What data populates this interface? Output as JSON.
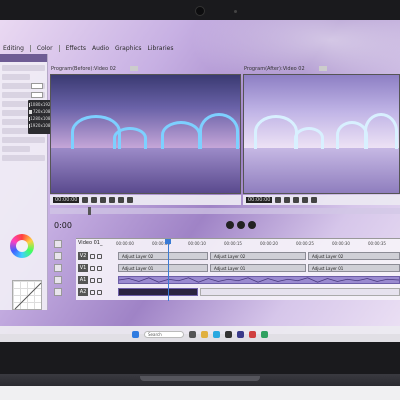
{
  "menu": {
    "items": [
      "Editing",
      "Color",
      "Effects",
      "Audio",
      "Graphics",
      "Libraries"
    ]
  },
  "left_panel": {
    "presets": [
      "1080x1920",
      "720x1080",
      "1280x1080",
      "1920x1080"
    ]
  },
  "monitors": {
    "before_title": "Program(Before):Video 02",
    "after_title": "Program(After):Video 02",
    "before_timecode": "00:00:00",
    "after_timecode": "00:00:00"
  },
  "playback": {
    "current_time": "0:00"
  },
  "timeline": {
    "sequence_tab": "Video 01_",
    "ruler": [
      "00:00:00",
      "00:00:05",
      "00:00:10",
      "00:00:15",
      "00:00:20",
      "00:00:25",
      "00:00:30",
      "00:00:35"
    ],
    "tracks": [
      {
        "label": "V2",
        "clip": "Adjust Layer 02"
      },
      {
        "label": "V1",
        "clip": "Adjust Layer 01"
      },
      {
        "label": "A1",
        "clip": ""
      },
      {
        "label": "A2",
        "clip": ""
      }
    ],
    "v2_clips": [
      "Adjust Layer 02",
      "Adjust Layer 02",
      "Adjust Layer 02"
    ],
    "v1_clips": [
      "Adjust Layer 01",
      "Adjust Layer 01",
      "Adjust Layer 01"
    ]
  },
  "taskbar": {
    "search_placeholder": "Search"
  },
  "colors": {
    "accent": "#6e5c94",
    "playhead": "#3a7bd5",
    "audio_clip": "#9a8ad0"
  }
}
